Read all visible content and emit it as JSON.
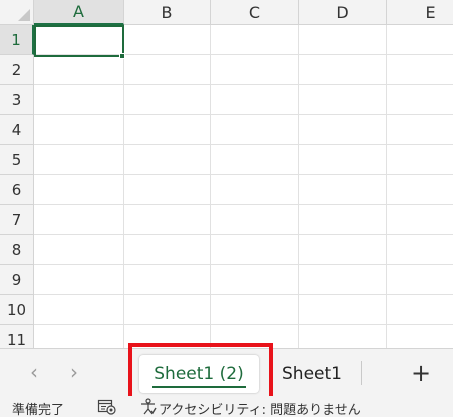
{
  "grid": {
    "columns": [
      "A",
      "B",
      "C",
      "D",
      "E"
    ],
    "rows": [
      "1",
      "2",
      "3",
      "4",
      "5",
      "6",
      "7",
      "8",
      "9",
      "10",
      "11"
    ],
    "selected_cell": "A1"
  },
  "tabbar": {
    "nav_prev": "‹",
    "nav_next": "›",
    "active_tab": "Sheet1 (2)",
    "inactive_tab": "Sheet1",
    "add_sheet": "+"
  },
  "statusbar": {
    "ready": "準備完了",
    "accessibility": "アクセシビリティ: 問題ありません"
  },
  "colors": {
    "accent": "#1e6b3c",
    "highlight": "#e8121a"
  }
}
